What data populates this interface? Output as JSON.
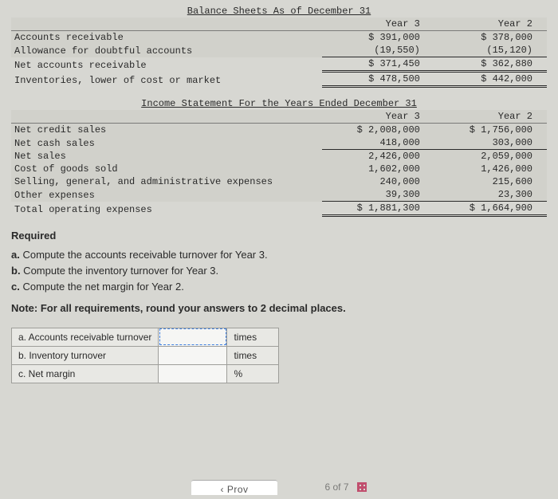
{
  "balance": {
    "title": "Balance Sheets As of December 31",
    "col_headers": [
      "Year 3",
      "Year 2"
    ],
    "rows": [
      {
        "label": "Accounts receivable",
        "y3": "$ 391,000",
        "y2": "$ 378,000"
      },
      {
        "label": "Allowance for doubtful accounts",
        "y3": "(19,550)",
        "y2": "(15,120)"
      },
      {
        "label": "Net accounts receivable",
        "y3": "$ 371,450",
        "y2": "$ 362,880"
      },
      {
        "label": "Inventories, lower of cost or market",
        "y3": "$ 478,500",
        "y2": "$ 442,000"
      }
    ]
  },
  "income": {
    "title": "Income Statement For the Years Ended December 31",
    "col_headers": [
      "Year 3",
      "Year 2"
    ],
    "rows": [
      {
        "label": "Net credit sales",
        "y3": "$ 2,008,000",
        "y2": "$ 1,756,000"
      },
      {
        "label": "Net cash sales",
        "y3": "418,000",
        "y2": "303,000"
      },
      {
        "label": "Net sales",
        "y3": "2,426,000",
        "y2": "2,059,000"
      },
      {
        "label": "Cost of goods sold",
        "y3": "1,602,000",
        "y2": "1,426,000"
      },
      {
        "label": "Selling, general, and administrative expenses",
        "y3": "240,000",
        "y2": "215,600"
      },
      {
        "label": "Other expenses",
        "y3": "39,300",
        "y2": "23,300"
      },
      {
        "label": "Total operating expenses",
        "y3": "$ 1,881,300",
        "y2": "$ 1,664,900"
      }
    ]
  },
  "required": {
    "heading": "Required",
    "a": "a. Compute the accounts receivable turnover for Year 3.",
    "b": "b. Compute the inventory turnover for Year 3.",
    "c": "c. Compute the net margin for Year 2.",
    "note": "Note: For all requirements, round your answers to 2 decimal places."
  },
  "answers": {
    "rows": [
      {
        "label": "a. Accounts receivable turnover",
        "unit": "times"
      },
      {
        "label": "b. Inventory turnover",
        "unit": "times"
      },
      {
        "label": "c. Net margin",
        "unit": "%"
      }
    ]
  },
  "footer": {
    "prev": "Prov",
    "page": "6 of 7"
  }
}
